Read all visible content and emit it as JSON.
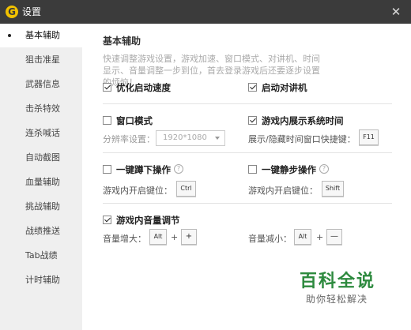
{
  "titlebar": {
    "logo_letter": "G",
    "title": "设置",
    "close_glyph": "✕"
  },
  "sidebar": {
    "items": [
      {
        "label": "基本辅助",
        "active": true
      },
      {
        "label": "狙击准星",
        "active": false
      },
      {
        "label": "武器信息",
        "active": false
      },
      {
        "label": "击杀特效",
        "active": false
      },
      {
        "label": "连杀喊话",
        "active": false
      },
      {
        "label": "自动截图",
        "active": false
      },
      {
        "label": "血量辅助",
        "active": false
      },
      {
        "label": "挑战辅助",
        "active": false
      },
      {
        "label": "战绩推送",
        "active": false
      },
      {
        "label": "Tab战绩",
        "active": false
      },
      {
        "label": "计时辅助",
        "active": false
      }
    ]
  },
  "main": {
    "section_title": "基本辅助",
    "description": "快速调整游戏设置，游戏加速、窗口模式、对讲机、时间显示、音量调整一步到位，首去登录游戏后还要逐步设置的烦恼！",
    "opt_boot_speed": {
      "label": "优化启动速度",
      "checked": true
    },
    "opt_walkie": {
      "label": "启动对讲机",
      "checked": true
    },
    "opt_window_mode": {
      "label": "窗口模式",
      "checked": false
    },
    "resolution": {
      "label": "分辨率设置：",
      "value": "1920*1080"
    },
    "opt_show_time": {
      "label": "游戏内展示系统时间",
      "checked": true
    },
    "time_hotkey": {
      "label": "展示/隐藏时间窗口快捷键：",
      "key": "F11"
    },
    "opt_squat": {
      "label": "一键蹲下操作",
      "checked": false,
      "help": "?"
    },
    "squat_key": {
      "label": "游戏内开启键位：",
      "key": "Ctrl"
    },
    "opt_silent": {
      "label": "一键静步操作",
      "checked": false,
      "help": "?"
    },
    "silent_key": {
      "label": "游戏内开启键位：",
      "key": "Shift"
    },
    "opt_volume": {
      "label": "游戏内音量调节",
      "checked": true
    },
    "vol_up": {
      "label": "音量增大：",
      "mod": "Alt",
      "plus": "+",
      "key": "+"
    },
    "vol_down": {
      "label": "音量减小：",
      "mod": "Alt",
      "plus": "+",
      "key": "—"
    }
  },
  "watermark": {
    "big": "百科全说",
    "small": "助你轻松解决"
  }
}
